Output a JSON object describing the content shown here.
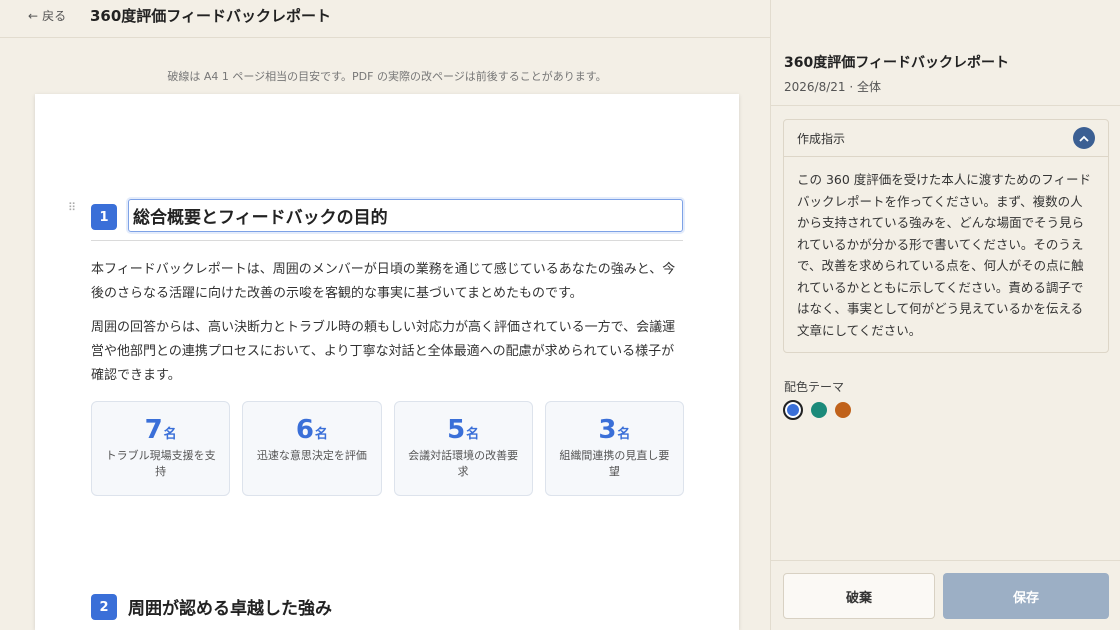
{
  "header": {
    "back_label": "戻る",
    "title": "360度評価フィードバックレポート"
  },
  "editor": {
    "page_note": "破線は A4 1 ページ相当の目安です。PDF の実際の改ページは前後することがあります。",
    "sections": [
      {
        "number": "1",
        "title": "総合概要とフィードバックの目的",
        "paragraphs": [
          "本フィードバックレポートは、周囲のメンバーが日頃の業務を通じて感じているあなたの強みと、今後のさらなる活躍に向けた改善の示唆を客観的な事実に基づいてまとめたものです。",
          "周囲の回答からは、高い決断力とトラブル時の頼もしい対応力が高く評価されている一方で、会議運営や他部門との連携プロセスにおいて、より丁寧な対話と全体最適への配慮が求められている様子が確認できます。"
        ],
        "stats": [
          {
            "value": "7",
            "unit": "名",
            "label": "トラブル現場支援を支持"
          },
          {
            "value": "6",
            "unit": "名",
            "label": "迅速な意思決定を評価"
          },
          {
            "value": "5",
            "unit": "名",
            "label": "会議対話環境の改善要求"
          },
          {
            "value": "3",
            "unit": "名",
            "label": "組織間連携の見直し要望"
          }
        ]
      },
      {
        "number": "2",
        "title": "周囲が認める卓越した強み"
      }
    ]
  },
  "sidebar": {
    "title": "360度評価フィードバックレポート",
    "meta": "2026/8/21 · 全体",
    "instructions": {
      "label": "作成指示",
      "text": "この 360 度評価を受けた本人に渡すためのフィードバックレポートを作ってください。まず、複数の人から支持されている強みを、どんな場面でそう見られているかが分かる形で書いてください。そのうえで、改善を求められている点を、何人がその点に触れているかとともに示してください。責める調子ではなく、事実として何がどう見えているかを伝える文章にしてください。"
    },
    "theme": {
      "label": "配色テーマ",
      "colors": [
        "#3a6fd8",
        "#1b8a7a",
        "#c0621b"
      ],
      "selected": 0
    },
    "discard_label": "破棄",
    "save_label": "保存"
  }
}
